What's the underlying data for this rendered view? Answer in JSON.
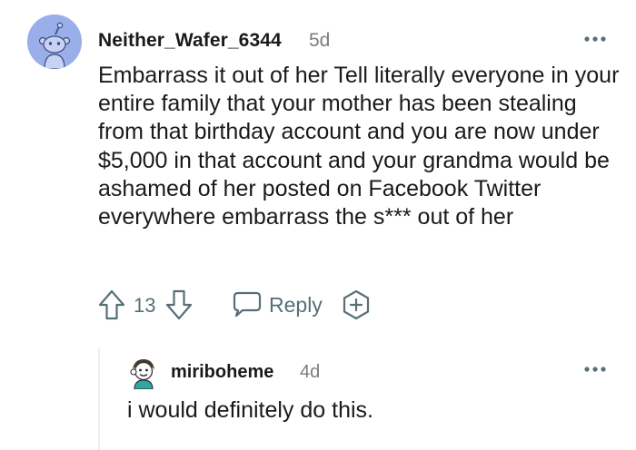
{
  "comment": {
    "username": "Neither_Wafer_6344",
    "age": "5d",
    "avatar_icon": "reddit-snoo-avatar-icon",
    "avatar_color": "#9aaeea",
    "body": "Embarrass it out of her Tell literally everyone in your entire family that your mother has been stealing from that birthday account and you are now under $5,000 in that account and your grandma would be ashamed of her posted on Facebook Twitter everywhere embarrass the s*** out of her",
    "votes": "13",
    "reply_label": "Reply",
    "icons": {
      "upvote": "upvote-arrow-icon",
      "downvote": "downvote-arrow-icon",
      "reply": "speech-bubble-icon",
      "award": "award-plus-icon",
      "more": "ellipsis-icon"
    }
  },
  "reply": {
    "username": "miriboheme",
    "age": "4d",
    "avatar_icon": "custom-avatar-icon",
    "body": "i would definitely do this."
  },
  "colors": {
    "text": "#1a1a1b",
    "meta": "#7c7c7c",
    "action": "#576f76",
    "thread_line": "#edeff1"
  }
}
